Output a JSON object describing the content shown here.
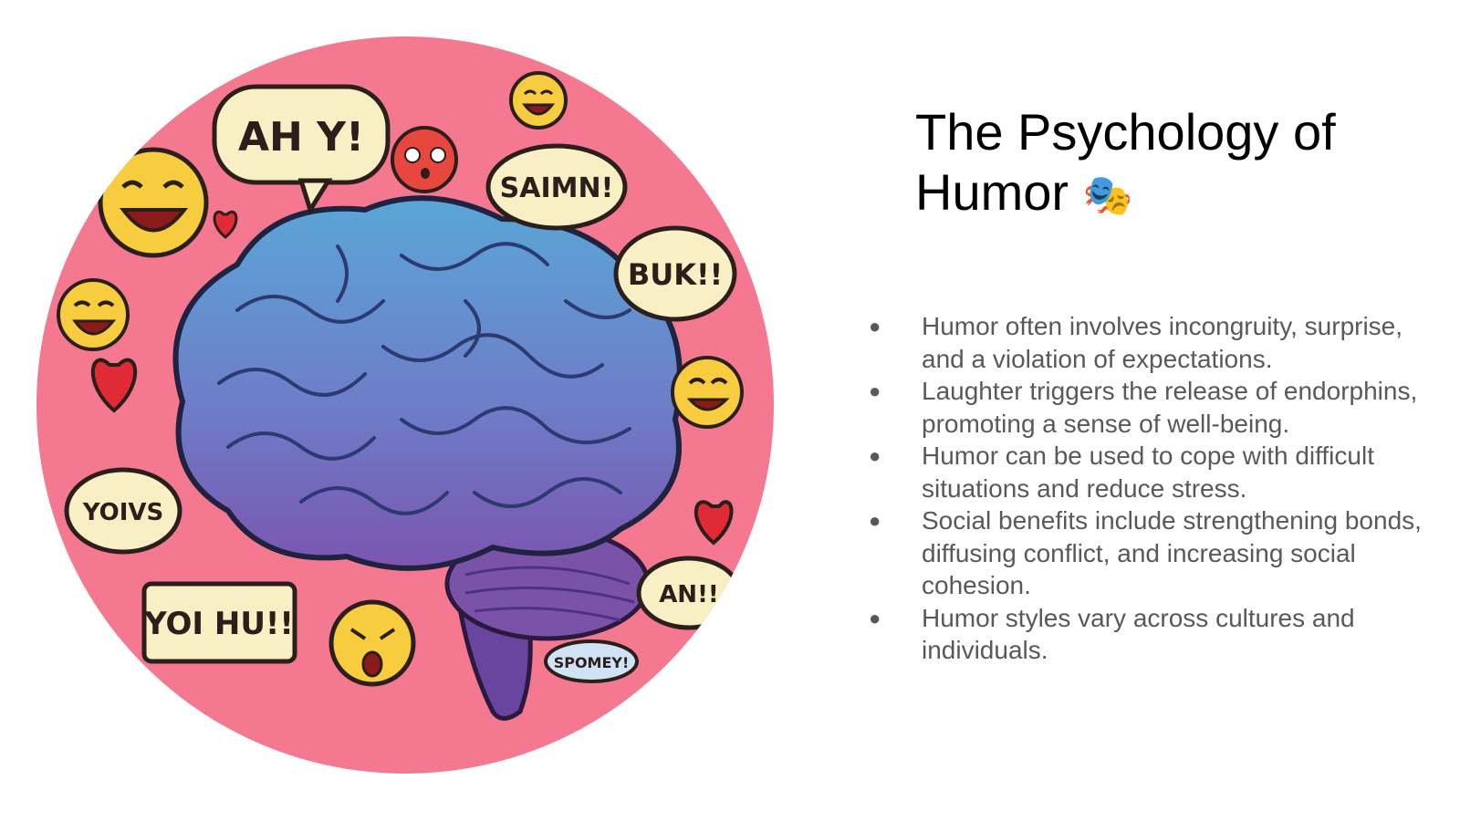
{
  "slide": {
    "title": "The Psychology of Humor",
    "title_emoji": "🎭",
    "bullet_marker": "●",
    "bullets": [
      "Humor often involves incongruity, surprise, and a violation of expectations.",
      "Laughter triggers the release of endorphins, promoting a sense of well-being.",
      "Humor can be used to cope with difficult situations and reduce stress.",
      "Social benefits include strengthening bonds, diffusing conflict, and increasing social cohesion.",
      "Humor styles vary across cultures and individuals."
    ]
  },
  "illustration": {
    "bubbles": {
      "ah_y": "AH Y!",
      "saimn": "SAIMN!",
      "buk": "BUK!!",
      "yoivs": "YOIVS",
      "yoi_hu": "YOI HU!!",
      "an": "AN!!",
      "spomey": "SPOMEY!"
    },
    "colors": {
      "background_circle": "#f4788f",
      "brain_top": "#5aa6d8",
      "brain_bottom": "#7b55b0",
      "emoji_face": "#f7cc3e",
      "bubble_fill": "#f8efc4",
      "heart": "#e02a35"
    }
  }
}
